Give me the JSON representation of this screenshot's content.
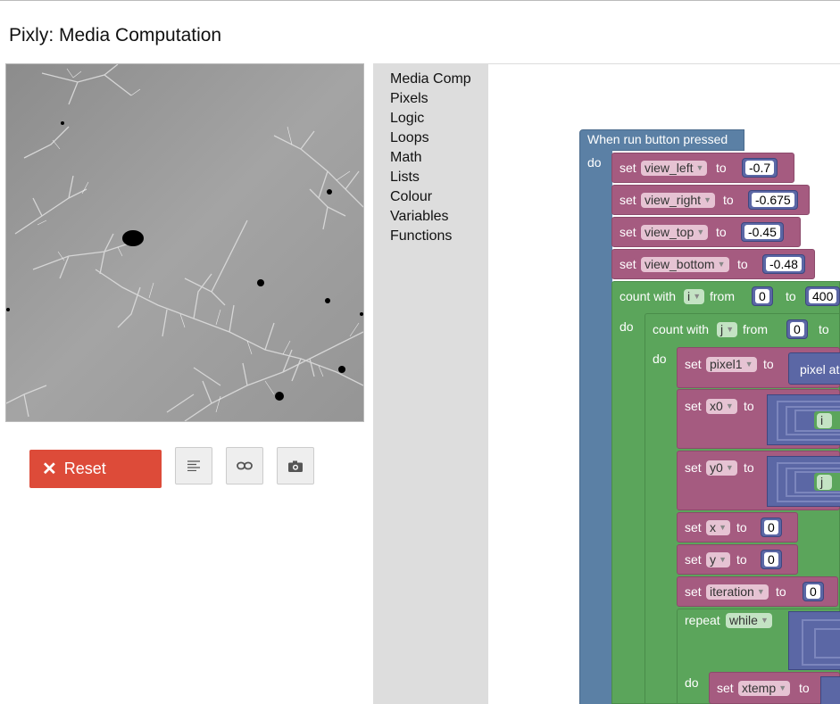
{
  "app": {
    "title": "Pixly: Media Computation"
  },
  "controls": {
    "reset_label": "Reset"
  },
  "toolbox": {
    "categories": [
      "Media Comp",
      "Pixels",
      "Logic",
      "Loops",
      "Math",
      "Lists",
      "Colour",
      "Variables",
      "Functions"
    ]
  },
  "workspace": {
    "event": "When run button pressed",
    "do": "do",
    "set": "set",
    "to": "to",
    "count_with": "count with",
    "from": "from",
    "repeat": "repeat",
    "vars": {
      "view_left": "view_left",
      "view_right": "view_right",
      "view_top": "view_top",
      "view_bottom": "view_bottom",
      "i": "i",
      "j": "j",
      "pixel1": "pixel1",
      "x0": "x0",
      "y0": "y0",
      "x": "x",
      "y": "y",
      "iteration": "iteration",
      "xtemp": "xtemp"
    },
    "values": {
      "view_left": "-0.7",
      "view_right": "-0.675",
      "view_top": "-0.45",
      "view_bottom": "-0.48",
      "i_from": "0",
      "i_to": "400",
      "j_from": "0",
      "x": "0",
      "y": "0",
      "iteration": "0"
    },
    "repeat_mode": "while",
    "pixel_at": "pixel at",
    "partial_i": "i",
    "partial_j": "j"
  },
  "colors": {
    "event": "#5b80a5",
    "variables": "#a55b80",
    "loops": "#5ba55b",
    "math": "#5b67a5",
    "reset": "#dd4b39",
    "toolbox": "#dddddd"
  }
}
